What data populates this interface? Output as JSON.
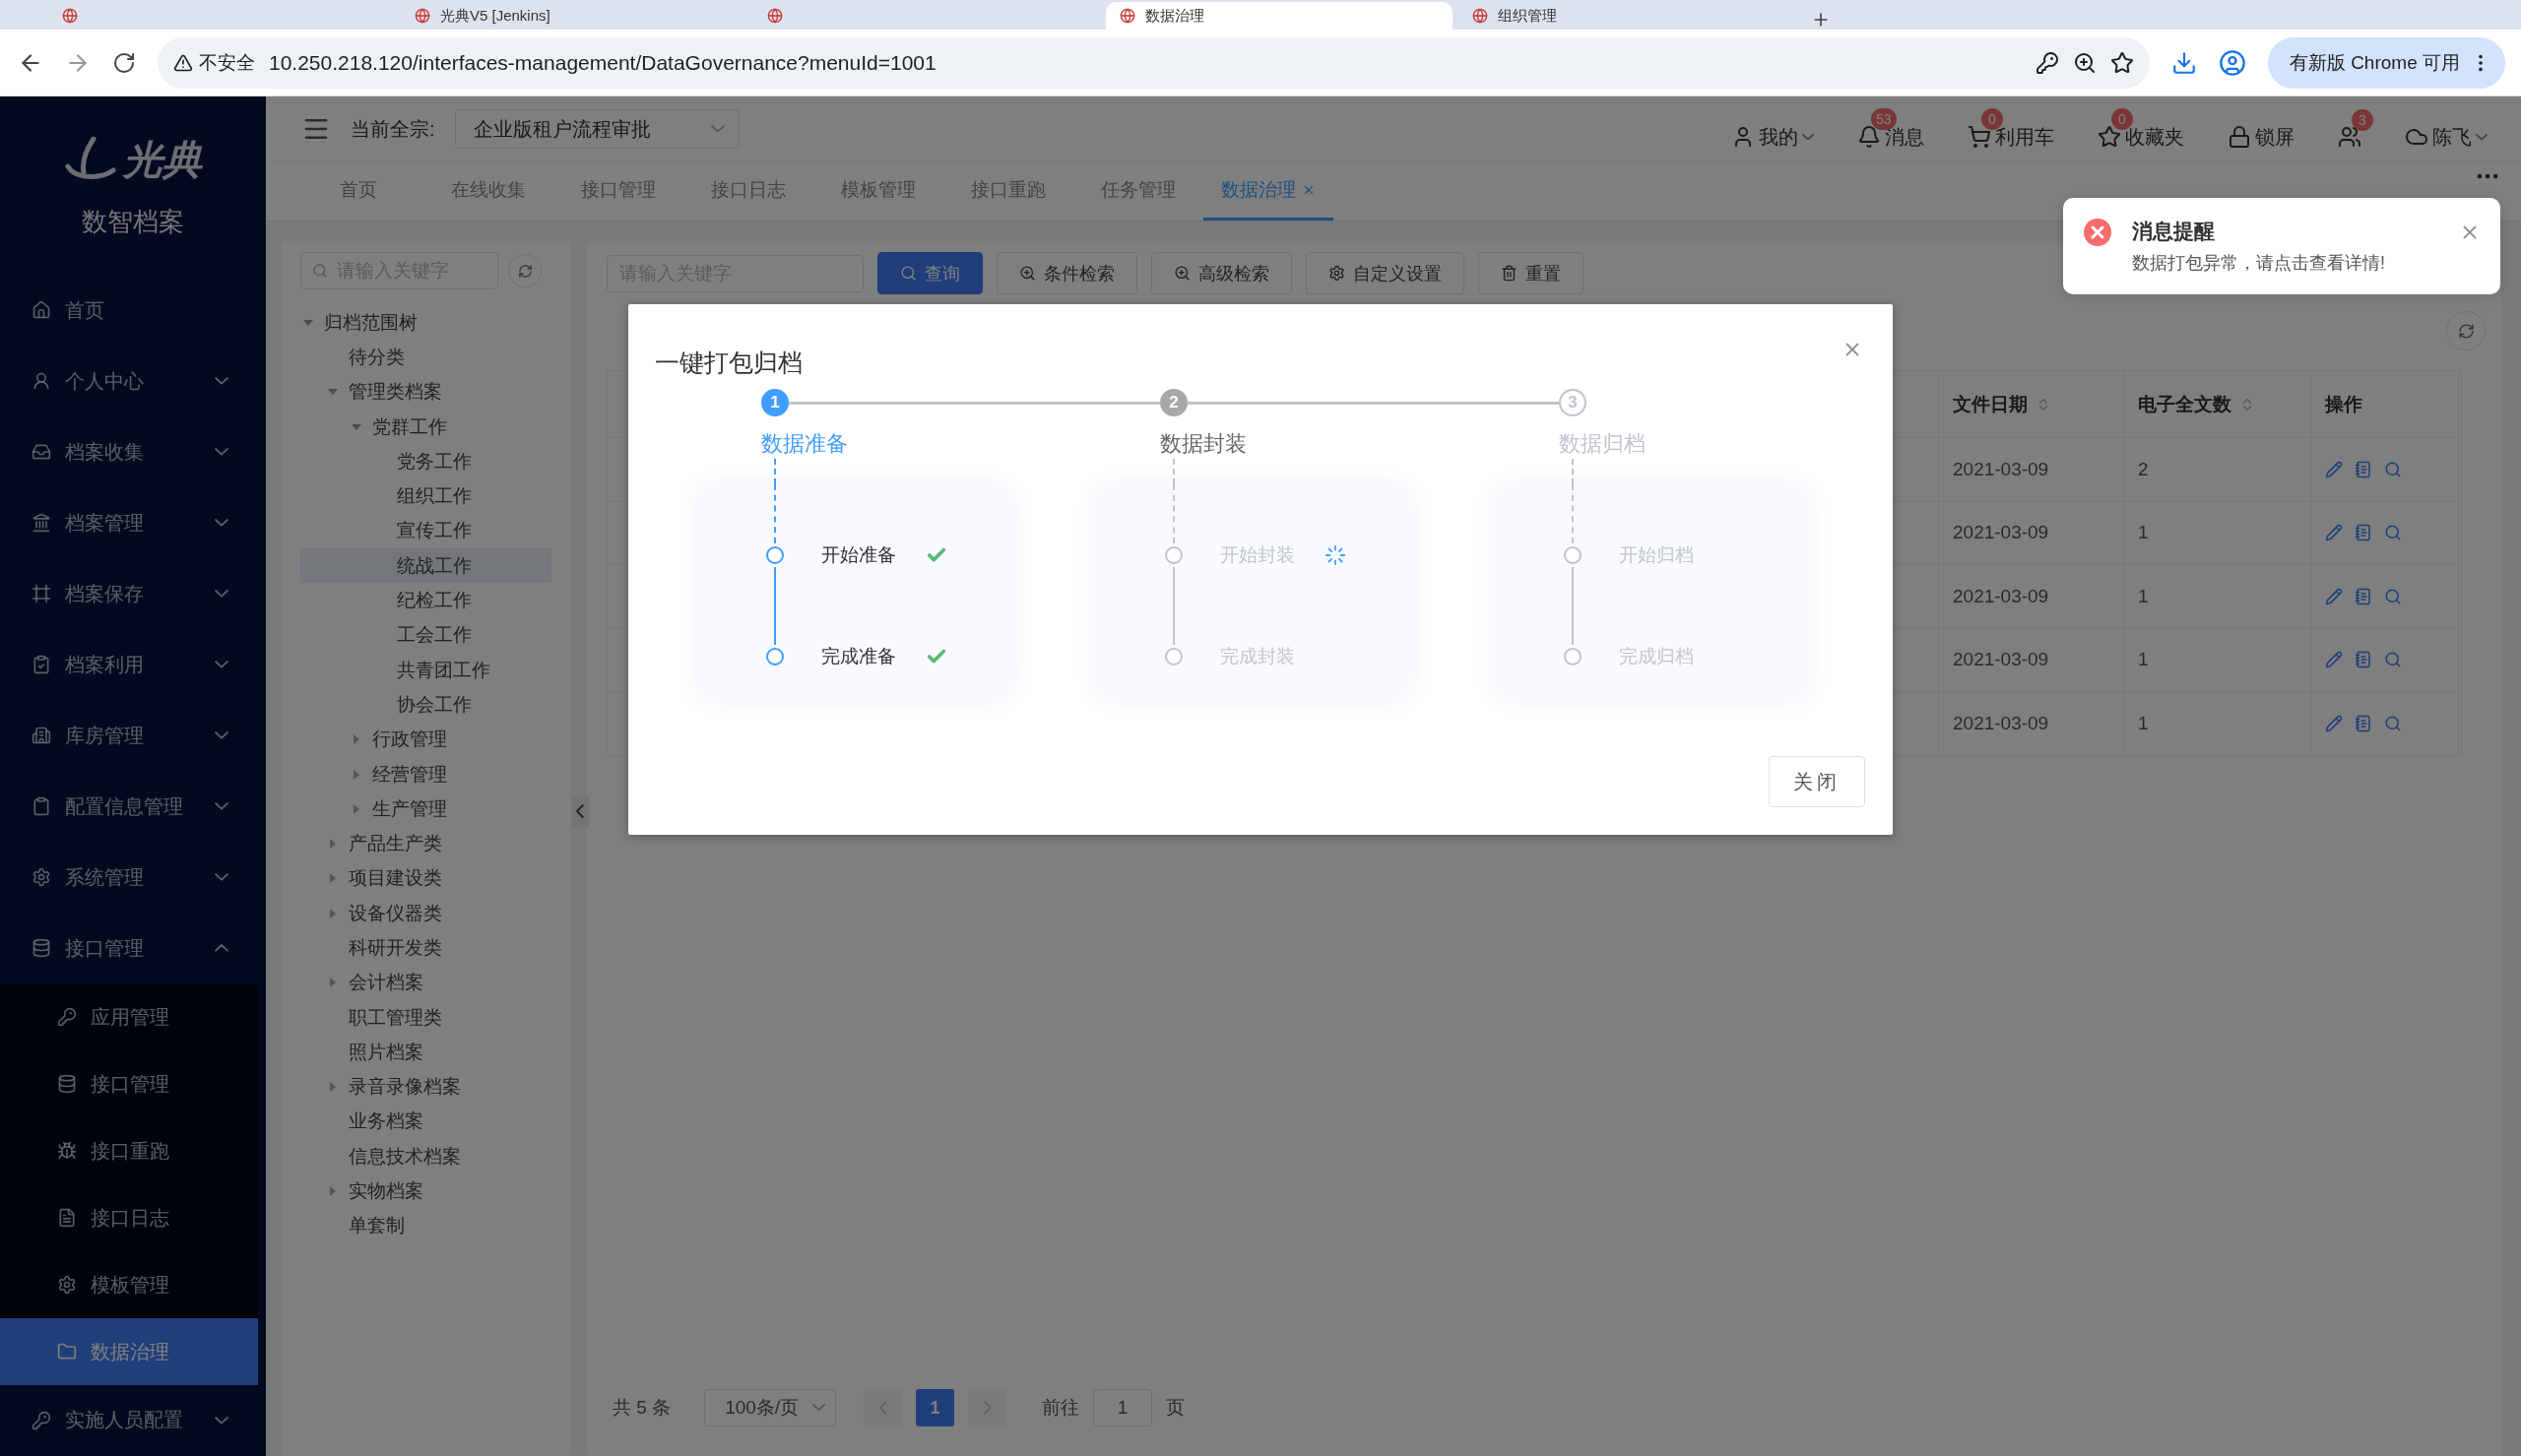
{
  "browser": {
    "tabs": [
      {
        "selected": false
      },
      {
        "title": "光典V5 [Jenkins]",
        "selected": false
      },
      {
        "selected": false
      },
      {
        "title": "数据治理",
        "selected": true
      },
      {
        "title": "组织管理",
        "selected": false
      }
    ],
    "security": "不安全",
    "url": "10.250.218.120/interfaces-management/DataGovernance?menuId=1001",
    "update_button": "有新版 Chrome 可用"
  },
  "sidebar": {
    "logo": "光典",
    "title": "数智档案",
    "items": [
      {
        "label": "首页",
        "kind": "link",
        "selected": false
      },
      {
        "label": "个人中心",
        "kind": "group",
        "expanded": false,
        "selected": false
      },
      {
        "label": "档案收集",
        "kind": "group",
        "expanded": false,
        "selected": false
      },
      {
        "label": "档案管理",
        "kind": "group",
        "expanded": false,
        "selected": false
      },
      {
        "label": "档案保存",
        "kind": "group",
        "expanded": false,
        "selected": false
      },
      {
        "label": "档案利用",
        "kind": "group",
        "expanded": false,
        "selected": false
      },
      {
        "label": "库房管理",
        "kind": "group",
        "expanded": false,
        "selected": false
      },
      {
        "label": "配置信息管理",
        "kind": "group",
        "expanded": false,
        "selected": false
      },
      {
        "label": "系统管理",
        "kind": "group",
        "expanded": false,
        "selected": false
      },
      {
        "label": "接口管理",
        "kind": "group",
        "expanded": true,
        "selected": false,
        "children": [
          {
            "label": "应用管理",
            "selected": false
          },
          {
            "label": "接口管理",
            "selected": false
          },
          {
            "label": "接口重跑",
            "selected": false
          },
          {
            "label": "接口日志",
            "selected": false
          },
          {
            "label": "模板管理",
            "selected": false
          },
          {
            "label": "数据治理",
            "selected": true
          }
        ]
      },
      {
        "label": "实施人员配置",
        "kind": "group",
        "expanded": false,
        "selected": false
      }
    ]
  },
  "header": {
    "fonds_label": "当前全宗:",
    "fonds_value": "企业版租户流程审批",
    "actions": [
      {
        "kind": "dropdown",
        "label": "我的"
      },
      {
        "kind": "link",
        "label": "消息",
        "badge": "53"
      },
      {
        "kind": "link",
        "label": "利用车",
        "badge": "0"
      },
      {
        "kind": "link",
        "label": "收藏夹",
        "badge": "0"
      },
      {
        "kind": "link",
        "label": "锁屏"
      },
      {
        "kind": "icon",
        "badge": "3"
      },
      {
        "kind": "dropdown",
        "label": "陈飞"
      }
    ]
  },
  "page_tabs": [
    {
      "label": "首页",
      "selected": false,
      "closable": false
    },
    {
      "label": "在线收集",
      "selected": false,
      "closable": false
    },
    {
      "label": "接口管理",
      "selected": false,
      "closable": false
    },
    {
      "label": "接口日志",
      "selected": false,
      "closable": false
    },
    {
      "label": "模板管理",
      "selected": false,
      "closable": false
    },
    {
      "label": "接口重跑",
      "selected": false,
      "closable": false
    },
    {
      "label": "任务管理",
      "selected": false,
      "closable": false
    },
    {
      "label": "数据治理",
      "selected": true,
      "closable": true
    }
  ],
  "tree": {
    "placeholder": "请输入关键字",
    "nodes": [
      {
        "label": "归档范围树",
        "selected": false,
        "expanded": true,
        "children": [
          {
            "label": "待分类",
            "selected": false
          },
          {
            "label": "管理类档案",
            "selected": false,
            "expanded": true,
            "children": [
              {
                "label": "党群工作",
                "selected": false,
                "expanded": true,
                "children": [
                  {
                    "label": "党务工作",
                    "selected": false
                  },
                  {
                    "label": "组织工作",
                    "selected": false
                  },
                  {
                    "label": "宣传工作",
                    "selected": false
                  },
                  {
                    "label": "统战工作",
                    "selected": true
                  },
                  {
                    "label": "纪检工作",
                    "selected": false
                  },
                  {
                    "label": "工会工作",
                    "selected": false
                  },
                  {
                    "label": "共青团工作",
                    "selected": false
                  },
                  {
                    "label": "协会工作",
                    "selected": false
                  }
                ]
              },
              {
                "label": "行政管理",
                "selected": false,
                "expanded": false
              },
              {
                "label": "经营管理",
                "selected": false,
                "expanded": false
              },
              {
                "label": "生产管理",
                "selected": false,
                "expanded": false
              }
            ]
          },
          {
            "label": "产品生产类",
            "selected": false,
            "expanded": false
          },
          {
            "label": "项目建设类",
            "selected": false,
            "expanded": false
          },
          {
            "label": "设备仪器类",
            "selected": false,
            "expanded": false
          },
          {
            "label": "科研开发类",
            "selected": false
          },
          {
            "label": "会计档案",
            "selected": false,
            "expanded": false
          },
          {
            "label": "职工管理类",
            "selected": false
          },
          {
            "label": "照片档案",
            "selected": false
          },
          {
            "label": "录音录像档案",
            "selected": false,
            "expanded": false
          },
          {
            "label": "业务档案",
            "selected": false
          },
          {
            "label": "信息技术档案",
            "selected": false
          },
          {
            "label": "实物档案",
            "selected": false,
            "expanded": false
          },
          {
            "label": "单套制",
            "selected": false
          }
        ]
      }
    ]
  },
  "toolbar": {
    "placeholder": "请输入关键字",
    "buttons": [
      {
        "label": "查询",
        "kind": "primary"
      },
      {
        "label": "条件检索",
        "kind": "filter"
      },
      {
        "label": "高级检索",
        "kind": "advanced"
      },
      {
        "label": "自定义设置",
        "kind": "settings"
      },
      {
        "label": "重置",
        "kind": "reset"
      }
    ]
  },
  "table": {
    "columns": [
      {
        "label": "文件日期",
        "sortable": true
      },
      {
        "label": "电子全文数",
        "sortable": true
      },
      {
        "label": "操作",
        "sortable": false
      }
    ],
    "rows": [
      [
        "2021-03-09",
        "2"
      ],
      [
        "2021-03-09",
        "1"
      ],
      [
        "2021-03-09",
        "1"
      ],
      [
        "2021-03-09",
        "1"
      ],
      [
        "2021-03-09",
        "1"
      ]
    ]
  },
  "pagination": {
    "total": "共 5 条",
    "page_size": "100条/页",
    "pages": [
      {
        "label": "1",
        "selected": true
      }
    ],
    "goto_label": "前往",
    "goto_value": "1",
    "page_suffix": "页"
  },
  "dialog": {
    "title": "一键打包归档",
    "steps": [
      {
        "number": "1",
        "title": "数据准备",
        "active": true,
        "started": true,
        "tasks": [
          {
            "label": "开始准备",
            "done": true,
            "loading": false
          },
          {
            "label": "完成准备",
            "done": true,
            "loading": false
          }
        ]
      },
      {
        "number": "2",
        "title": "数据封装",
        "active": false,
        "started": true,
        "tasks": [
          {
            "label": "开始封装",
            "done": false,
            "loading": true
          },
          {
            "label": "完成封装",
            "done": false,
            "loading": false
          }
        ]
      },
      {
        "number": "3",
        "title": "数据归档",
        "active": false,
        "started": false,
        "tasks": [
          {
            "label": "开始归档",
            "done": false,
            "loading": false
          },
          {
            "label": "完成归档",
            "done": false,
            "loading": false
          }
        ]
      }
    ],
    "close_button": "关闭"
  },
  "notification": {
    "error": true,
    "title": "消息提醒",
    "message": "数据打包异常，请点击查看详情!"
  }
}
